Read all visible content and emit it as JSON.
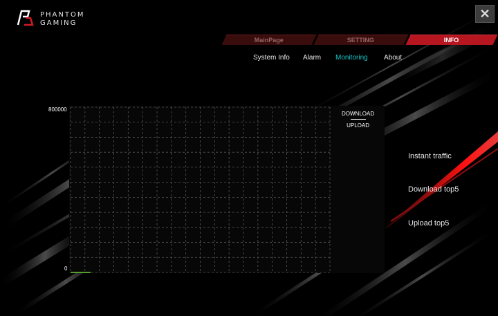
{
  "app": {
    "brand_line1": "PHANTOM",
    "brand_line2": "GAMING"
  },
  "window": {
    "close_label": "✕"
  },
  "tabs": [
    {
      "label": "MainPage",
      "active": false
    },
    {
      "label": "SETTING",
      "active": false
    },
    {
      "label": "INFO",
      "active": true
    }
  ],
  "subnav": [
    {
      "label": "System Info",
      "active": false
    },
    {
      "label": "Alarm",
      "active": false
    },
    {
      "label": "Monitoring",
      "active": true
    },
    {
      "label": "About",
      "active": false
    }
  ],
  "legend": {
    "download": "DOWNLOAD",
    "upload": "UPLOAD"
  },
  "side_menu": [
    {
      "label": "Instant traffic"
    },
    {
      "label": "Download top5"
    },
    {
      "label": "Upload top5"
    }
  ],
  "colors": {
    "accent_red": "#b51620",
    "active_cyan": "#19c6c9",
    "series_line": "#6fcf3a",
    "grid": "#555555"
  },
  "chart_data": {
    "type": "line",
    "y_tick_labels": [
      "800000",
      "0"
    ],
    "ylim": [
      0,
      800000
    ],
    "grid": true,
    "x": [
      0,
      1
    ],
    "series": [
      {
        "values": [
          0,
          0
        ]
      }
    ]
  }
}
